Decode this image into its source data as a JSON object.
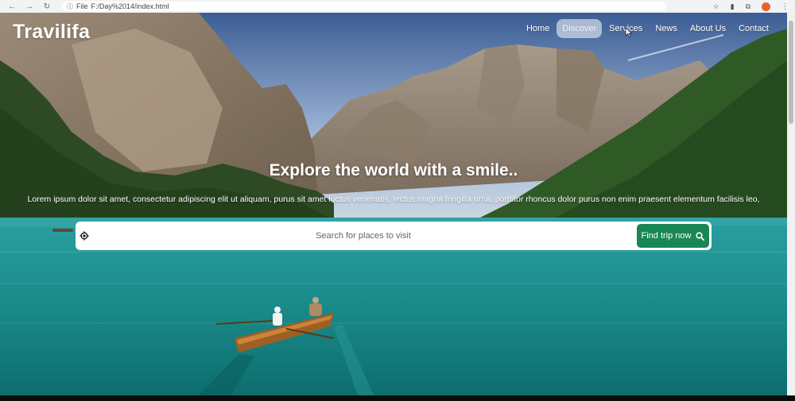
{
  "browser": {
    "url_prefix": "File",
    "url": "F:/Day%2014/index.html"
  },
  "brand": "Travilifa",
  "nav": {
    "items": [
      {
        "label": "Home"
      },
      {
        "label": "Discover"
      },
      {
        "label": "Services"
      },
      {
        "label": "News"
      },
      {
        "label": "About Us"
      },
      {
        "label": "Contact"
      }
    ],
    "active_index": 1
  },
  "hero": {
    "headline": "Explore the world with a smile..",
    "subtext": "Lorem ipsum dolor sit amet, consectetur adipiscing elit ut aliquam, purus sit amet luctus venenatis, lectus magna fringilla urna, porttitor rhoncus dolor purus non enim praesent elementum facilisis leo,"
  },
  "search": {
    "placeholder": "Search for places to visit",
    "value": "",
    "button_label": "Find trip now"
  },
  "colors": {
    "button_green": "#198754",
    "active_nav_bg": "#d7dbe6",
    "water": "#1c8d8c"
  },
  "icons": {
    "location": "location-target-icon",
    "search": "search-icon",
    "star": "star-icon",
    "extension": "puzzle-icon"
  }
}
